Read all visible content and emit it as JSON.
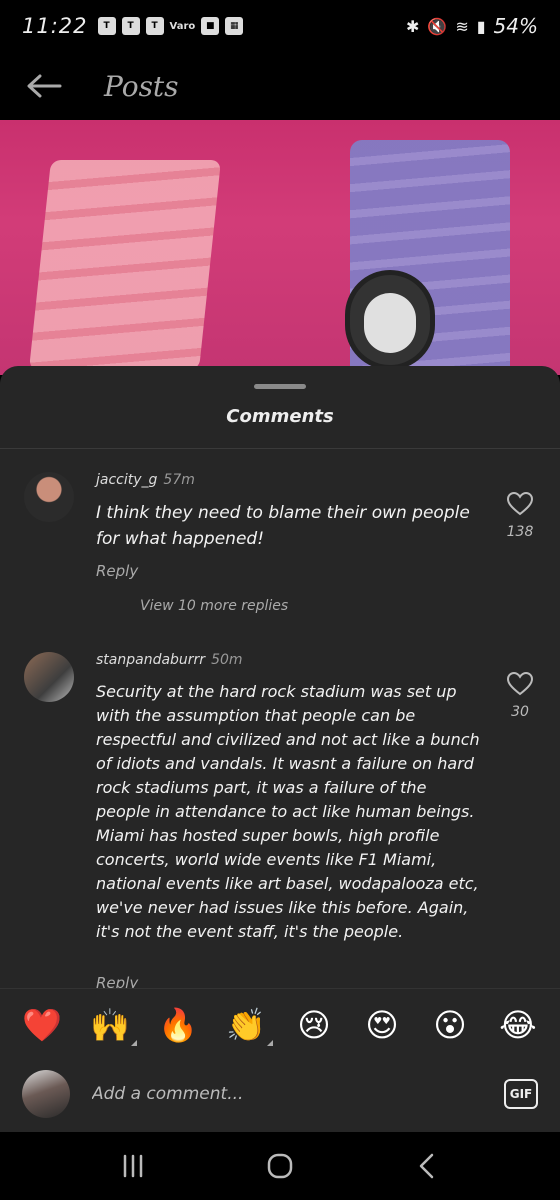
{
  "status_bar": {
    "time": "11:22",
    "notification_label": "Varo",
    "battery": "54%"
  },
  "app_bar": {
    "title": "Posts"
  },
  "sheet": {
    "title": "Comments"
  },
  "comments": [
    {
      "username": "jaccity_g",
      "time": "57m",
      "text": "I think they need to blame their own people for what happened!",
      "reply_label": "Reply",
      "like_count": "138",
      "view_replies": "View 10 more replies"
    },
    {
      "username": "stanpandaburrr",
      "time": "50m",
      "text": "Security at the hard rock stadium was set up with the assumption that people can be respectful and civilized and not act like a bunch of idiots and vandals.  It wasnt a failure on hard rock stadiums part, it was a failure of the people in attendance to act like human beings. Miami has hosted super bowls, high profile concerts, world wide events like F1 Miami, national events like art basel, wodapalooza etc, we've never had issues like this before.  Again, it's not the event staff, it's the people.",
      "reply_label": "Reply",
      "like_count": "30"
    }
  ],
  "emoji_bar": [
    "❤️",
    "🙌",
    "🔥",
    "👏",
    "😢",
    "😍",
    "😮",
    "😂"
  ],
  "input": {
    "placeholder": "Add a comment...",
    "gif_label": "GIF"
  },
  "colors": {
    "sheet_bg": "#262626",
    "background": "#000000",
    "heart": "#ff2d55"
  }
}
